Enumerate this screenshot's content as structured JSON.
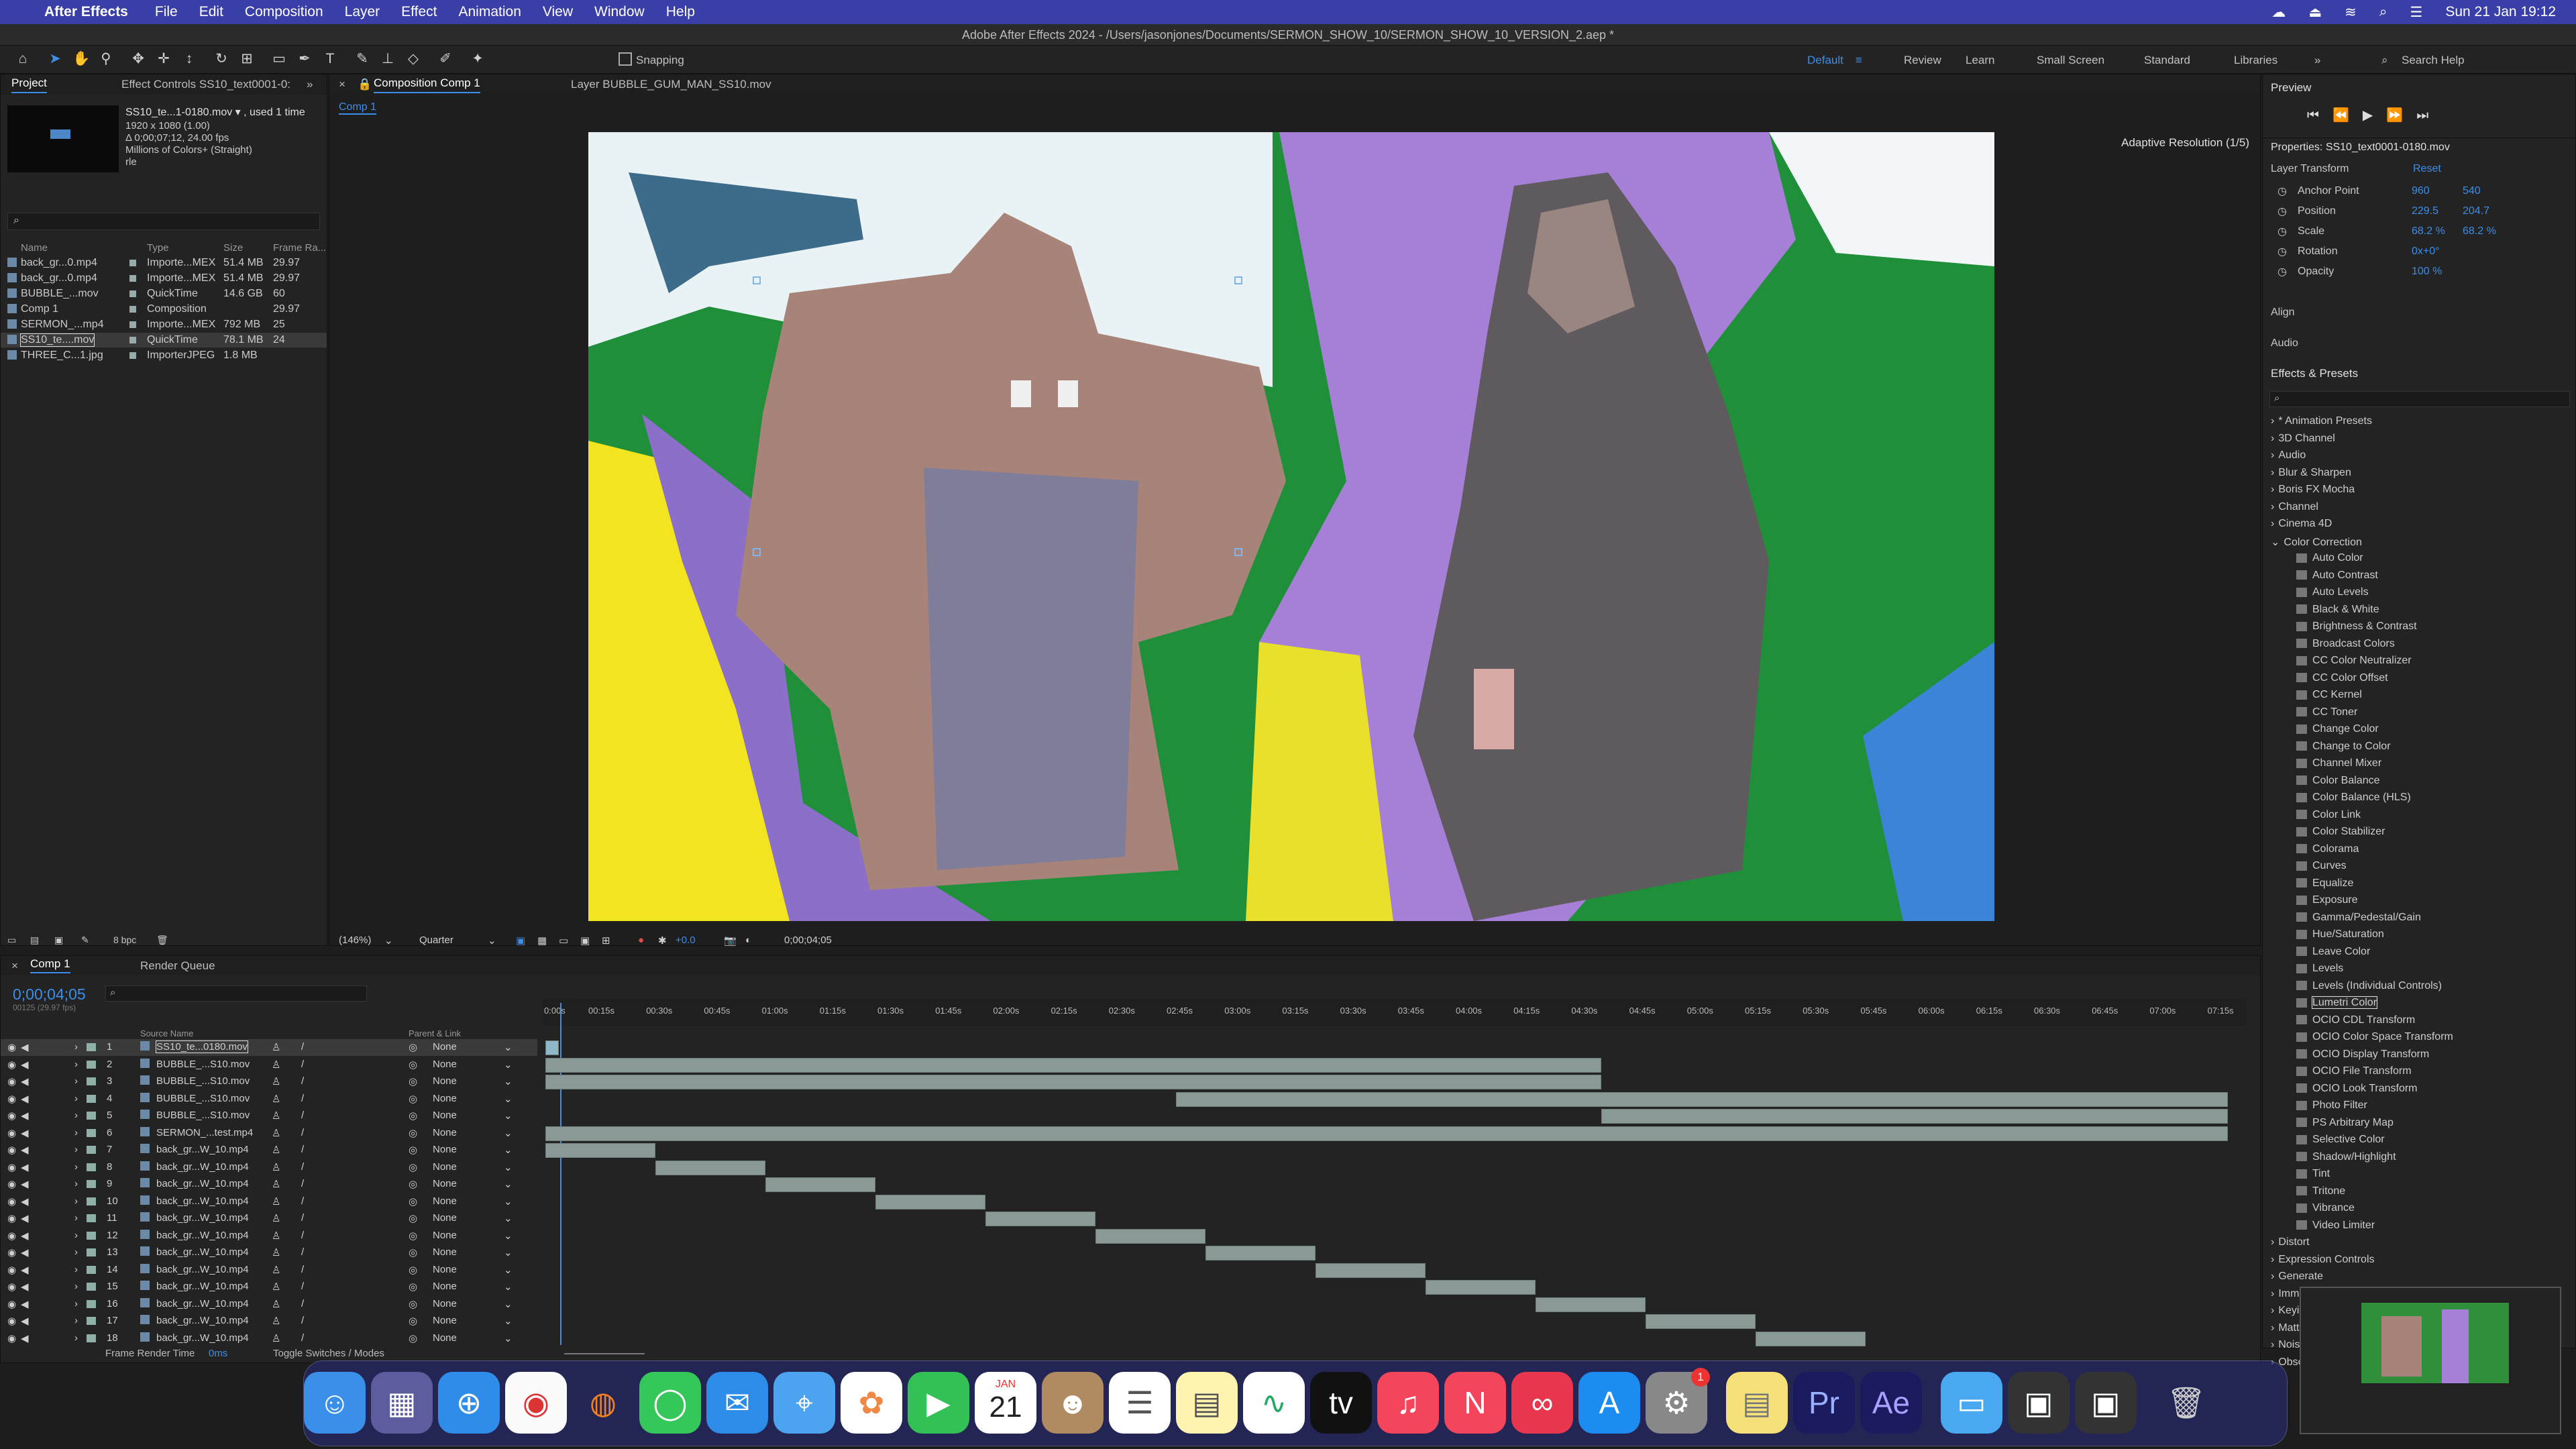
{
  "menubar": {
    "app": "After Effects",
    "items": [
      "File",
      "Edit",
      "Composition",
      "Layer",
      "Effect",
      "Animation",
      "View",
      "Window",
      "Help"
    ],
    "clock": "Sun 21 Jan  19:12"
  },
  "title": "Adobe After Effects 2024 - /Users/jasonjones/Documents/SERMON_SHOW_10/SERMON_SHOW_10_VERSION_2.aep *",
  "toolbar": {
    "snapping": "Snapping",
    "workspaces": [
      "Default",
      "Review",
      "Learn",
      "Small Screen",
      "Standard",
      "Libraries"
    ],
    "search": "Search Help"
  },
  "project": {
    "tab": "Project",
    "effect_tab": "Effect Controls SS10_text0001-0:",
    "selected_name": "SS10_te...1-0180.mov ▾ , used 1 time",
    "info": [
      "1920 x 1080 (1.00)",
      "Δ 0;00;07;12, 24.00 fps",
      "Millions of Colors+ (Straight)",
      "rle"
    ],
    "headers": [
      "Name",
      "Type",
      "Size",
      "Frame Ra..."
    ],
    "items": [
      {
        "name": "back_gr...0.mp4",
        "type": "Importe...MEX",
        "size": "51.4 MB",
        "fps": "29.97"
      },
      {
        "name": "back_gr...0.mp4",
        "type": "Importe...MEX",
        "size": "51.4 MB",
        "fps": "29.97"
      },
      {
        "name": "BUBBLE_...mov",
        "type": "QuickTime",
        "size": "14.6 GB",
        "fps": "60"
      },
      {
        "name": "Comp 1",
        "type": "Composition",
        "size": "",
        "fps": "29.97"
      },
      {
        "name": "SERMON_...mp4",
        "type": "Importe...MEX",
        "size": "792 MB",
        "fps": "25"
      },
      {
        "name": "SS10_te....mov",
        "type": "QuickTime",
        "size": "78.1 MB",
        "fps": "24"
      },
      {
        "name": "THREE_C...1.jpg",
        "type": "ImporterJPEG",
        "size": "1.8 MB",
        "fps": ""
      }
    ],
    "bpc": "8 bpc"
  },
  "comp": {
    "tab": "Composition Comp 1",
    "layer_tab": "Layer BUBBLE_GUM_MAN_SS10.mov",
    "sub": "Comp 1",
    "adaptive": "Adaptive Resolution (1/5)",
    "zoom": "(146%)",
    "quality": "Quarter",
    "exposure": "+0.0",
    "timecode": "0;00;04;05"
  },
  "preview": {
    "title": "Preview"
  },
  "properties": {
    "title": "Properties: SS10_text0001-0180.mov",
    "section": "Layer Transform",
    "reset": "Reset",
    "rows": [
      {
        "label": "Anchor Point",
        "v1": "960",
        "v2": "540"
      },
      {
        "label": "Position",
        "v1": "229.5",
        "v2": "204.7"
      },
      {
        "label": "Scale",
        "v1": "68.2 %",
        "v2": "68.2 %"
      },
      {
        "label": "Rotation",
        "v1": "0x+0°",
        "v2": ""
      },
      {
        "label": "Opacity",
        "v1": "100 %",
        "v2": ""
      }
    ],
    "align": "Align",
    "audio": "Audio"
  },
  "effects": {
    "title": "Effects & Presets",
    "categories": [
      "* Animation Presets",
      "3D Channel",
      "Audio",
      "Blur & Sharpen",
      "Boris FX Mocha",
      "Channel",
      "Cinema 4D",
      "Color Correction"
    ],
    "items": [
      "Auto Color",
      "Auto Contrast",
      "Auto Levels",
      "Black & White",
      "Brightness & Contrast",
      "Broadcast Colors",
      "CC Color Neutralizer",
      "CC Color Offset",
      "CC Kernel",
      "CC Toner",
      "Change Color",
      "Change to Color",
      "Channel Mixer",
      "Color Balance",
      "Color Balance (HLS)",
      "Color Link",
      "Color Stabilizer",
      "Colorama",
      "Curves",
      "Equalize",
      "Exposure",
      "Gamma/Pedestal/Gain",
      "Hue/Saturation",
      "Leave Color",
      "Levels",
      "Levels (Individual Controls)",
      "Lumetri Color",
      "OCIO CDL Transform",
      "OCIO Color Space Transform",
      "OCIO Display Transform",
      "OCIO File Transform",
      "OCIO Look Transform",
      "Photo Filter",
      "PS Arbitrary Map",
      "Selective Color",
      "Shadow/Highlight",
      "Tint",
      "Tritone",
      "Vibrance",
      "Video Limiter"
    ],
    "after": [
      "Distort",
      "Expression Controls",
      "Generate",
      "Imm",
      "Keyi",
      "Matt",
      "Nois",
      "Obso"
    ]
  },
  "timeline": {
    "tab": "Comp 1",
    "render_queue": "Render Queue",
    "timecode": "0;00;04;05",
    "fps": "00125 (29.97 fps)",
    "col_source": "Source Name",
    "col_parent": "Parent & Link",
    "ruler": [
      "00:15s",
      "00:30s",
      "00:45s",
      "01:00s",
      "01:15s",
      "01:30s",
      "01:45s",
      "02:00s",
      "02:15s",
      "02:30s",
      "02:45s",
      "03:00s",
      "03:15s",
      "03:30s",
      "03:45s",
      "04:00s",
      "04:15s",
      "04:30s",
      "04:45s",
      "05:00s",
      "05:15s",
      "05:30s",
      "05:45s",
      "06:00s",
      "06:15s",
      "06:30s",
      "06:45s",
      "07:00s",
      "07:15s"
    ],
    "layers": [
      {
        "n": "1",
        "name": "SS10_te...0180.mov",
        "parent": "None"
      },
      {
        "n": "2",
        "name": "BUBBLE_...S10.mov",
        "parent": "None"
      },
      {
        "n": "3",
        "name": "BUBBLE_...S10.mov",
        "parent": "None"
      },
      {
        "n": "4",
        "name": "BUBBLE_...S10.mov",
        "parent": "None"
      },
      {
        "n": "5",
        "name": "BUBBLE_...S10.mov",
        "parent": "None"
      },
      {
        "n": "6",
        "name": "SERMON_...test.mp4",
        "parent": "None"
      },
      {
        "n": "7",
        "name": "back_gr...W_10.mp4",
        "parent": "None"
      },
      {
        "n": "8",
        "name": "back_gr...W_10.mp4",
        "parent": "None"
      },
      {
        "n": "9",
        "name": "back_gr...W_10.mp4",
        "parent": "None"
      },
      {
        "n": "10",
        "name": "back_gr...W_10.mp4",
        "parent": "None"
      },
      {
        "n": "11",
        "name": "back_gr...W_10.mp4",
        "parent": "None"
      },
      {
        "n": "12",
        "name": "back_gr...W_10.mp4",
        "parent": "None"
      },
      {
        "n": "13",
        "name": "back_gr...W_10.mp4",
        "parent": "None"
      },
      {
        "n": "14",
        "name": "back_gr...W_10.mp4",
        "parent": "None"
      },
      {
        "n": "15",
        "name": "back_gr...W_10.mp4",
        "parent": "None"
      },
      {
        "n": "16",
        "name": "back_gr...W_10.mp4",
        "parent": "None"
      },
      {
        "n": "17",
        "name": "back_gr...W_10.mp4",
        "parent": "None"
      },
      {
        "n": "18",
        "name": "back_gr...W_10.mp4",
        "parent": "None"
      }
    ],
    "footer_render": "Frame Render Time",
    "footer_ms": "0ms",
    "footer_toggle": "Toggle Switches / Modes"
  },
  "dock": {
    "calendar_month": "JAN",
    "calendar_day": "21",
    "badge": "1"
  }
}
